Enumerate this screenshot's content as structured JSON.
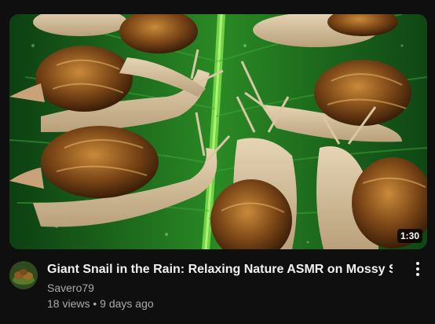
{
  "video": {
    "title": "Giant Snail in the Rain: Relaxing Nature ASMR on Mossy Stone",
    "channel": "Savero79",
    "views": "18 views",
    "separator": "•",
    "age": "9 days ago",
    "duration": "1:30"
  },
  "thumbnail": {
    "subject": "snails on a wet green leaf",
    "icon": "video-thumbnail"
  },
  "menu": {
    "icon": "more-vert-icon"
  },
  "colors": {
    "background": "#0f0f0f",
    "title": "#f1f1f1",
    "secondary_text": "#aaaaaa",
    "leaf": "#1f6e1f",
    "shell": "#7a4a1a"
  }
}
